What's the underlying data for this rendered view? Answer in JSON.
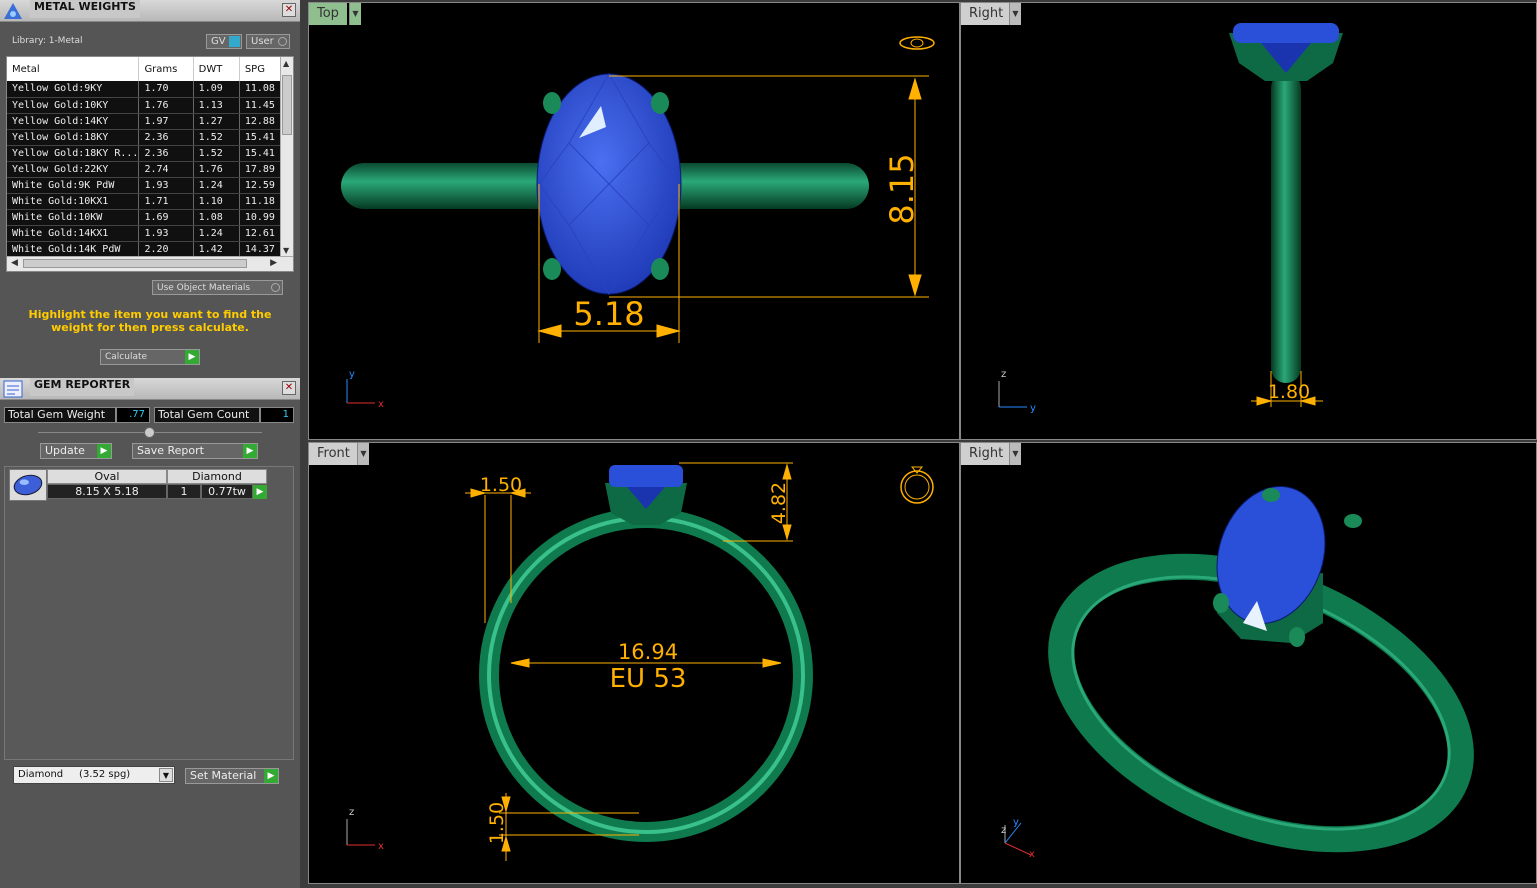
{
  "metal_panel": {
    "title": "METAL WEIGHTS",
    "library": "Library: 1-Metal",
    "gv_label": "GV",
    "user_label": "User",
    "columns": [
      "Metal",
      "Grams",
      "DWT",
      "SPG"
    ],
    "rows": [
      [
        "Yellow Gold:9KY",
        "1.70",
        "1.09",
        "11.08"
      ],
      [
        "Yellow Gold:10KY",
        "1.76",
        "1.13",
        "11.45"
      ],
      [
        "Yellow Gold:14KY",
        "1.97",
        "1.27",
        "12.88"
      ],
      [
        "Yellow Gold:18KY",
        "2.36",
        "1.52",
        "15.41"
      ],
      [
        "Yellow Gold:18KY R...",
        "2.36",
        "1.52",
        "15.41"
      ],
      [
        "Yellow Gold:22KY",
        "2.74",
        "1.76",
        "17.89"
      ],
      [
        "White Gold:9K PdW",
        "1.93",
        "1.24",
        "12.59"
      ],
      [
        "White Gold:10KX1",
        "1.71",
        "1.10",
        "11.18"
      ],
      [
        "White Gold:10KW",
        "1.69",
        "1.08",
        "10.99"
      ],
      [
        "White Gold:14KX1",
        "1.93",
        "1.24",
        "12.61"
      ],
      [
        "White Gold:14K PdW",
        "2.20",
        "1.42",
        "14.37"
      ]
    ],
    "use_object_materials": "Use Object Materials",
    "hint": "Highlight the item you want to find the weight for then press calculate.",
    "calculate_label": "Calculate"
  },
  "gem_panel": {
    "title": "GEM REPORTER",
    "total_weight_label": "Total Gem Weight",
    "total_weight_value": ".77",
    "total_count_label": "Total Gem Count",
    "total_count_value": "1",
    "update_label": "Update",
    "save_report_label": "Save Report",
    "gem_shape": "Oval",
    "gem_material": "Diamond",
    "gem_size": "8.15 X 5.18",
    "gem_qty": "1",
    "gem_weight": "0.77tw",
    "material_select": "Diamond     (3.52 spg)",
    "set_material_label": "Set Material"
  },
  "viewports": {
    "top": {
      "label": "Top",
      "dim_height": "8.15",
      "dim_width": "5.18",
      "axis_v": "y",
      "axis_h": "x"
    },
    "right": {
      "label": "Right",
      "dim_shank": "1.80",
      "axis_v": "z",
      "axis_h": "y"
    },
    "front": {
      "label": "Front",
      "dim_prong": "1.50",
      "dim_head": "4.82",
      "dim_inner": "16.94",
      "size": "EU 53",
      "dim_bottom": "1.50",
      "axis_v": "z",
      "axis_h": "x"
    },
    "perspective": {
      "label": "Right",
      "axis_v": "z",
      "axis_y": "y",
      "axis_h": "x"
    }
  },
  "colors": {
    "gem": "#2a4fd8",
    "metal": "#0e7a4e",
    "dimension": "#ffb000",
    "active_tab": "#8fbf8f"
  }
}
